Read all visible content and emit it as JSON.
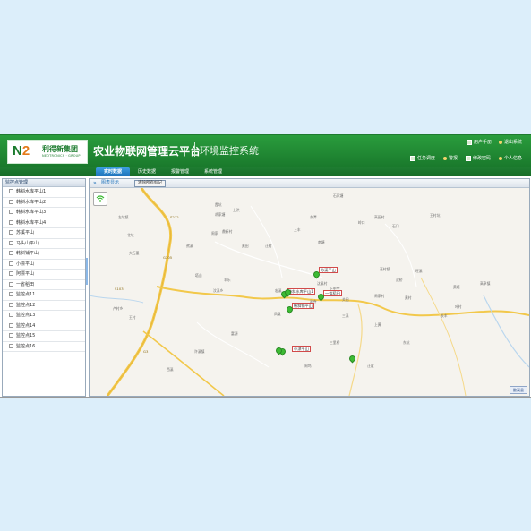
{
  "brand": {
    "mark_n": "N",
    "mark_2": "2",
    "name_cn": "利得新集团",
    "name_en": "NEOTRONICS · GROUP"
  },
  "header": {
    "title": "农业物联网管理云平台",
    "subtitle": "环境监控系统"
  },
  "top_links": [
    {
      "label": "用户手册"
    },
    {
      "label": "退出系统"
    }
  ],
  "tools": [
    {
      "label": "任务调度"
    },
    {
      "label": "警报"
    },
    {
      "label": "修改密码"
    },
    {
      "label": "个人信息"
    }
  ],
  "nav": {
    "tabs": [
      {
        "label": "实时数据",
        "active": true
      },
      {
        "label": "历史数据",
        "active": false
      },
      {
        "label": "报警管理",
        "active": false
      },
      {
        "label": "系统管理",
        "active": false
      }
    ]
  },
  "sidebar": {
    "title": "监控点管理",
    "items": [
      {
        "label": "韩斜水库平山1"
      },
      {
        "label": "韩斜水库平山2"
      },
      {
        "label": "韩斜水库平山3"
      },
      {
        "label": "韩斜水库平山4"
      },
      {
        "label": "苏溪平山"
      },
      {
        "label": "马头山平山"
      },
      {
        "label": "韩斜铺平山"
      },
      {
        "label": "小漂平山"
      },
      {
        "label": "阿漂平山"
      },
      {
        "label": "一省稻田"
      },
      {
        "label": "监控点11"
      },
      {
        "label": "监控点12"
      },
      {
        "label": "监控点13"
      },
      {
        "label": "监控点14"
      },
      {
        "label": "监控点15"
      },
      {
        "label": "监控点16"
      }
    ]
  },
  "main": {
    "title": "图表显示",
    "clear_button": "清除所有标记"
  },
  "map": {
    "places": [
      {
        "label": "左坑镇"
      },
      {
        "label": "石家塘"
      },
      {
        "label": "胡家塘"
      },
      {
        "label": "岭口"
      },
      {
        "label": "高田村"
      },
      {
        "label": "石门"
      },
      {
        "label": "霞坑"
      },
      {
        "label": "上洪"
      },
      {
        "label": "大石墨"
      },
      {
        "label": "北坑"
      },
      {
        "label": "周家"
      },
      {
        "label": "熬溪"
      },
      {
        "label": "上丰"
      },
      {
        "label": "汪村"
      },
      {
        "label": "黄田"
      },
      {
        "label": "王村坑"
      },
      {
        "label": "鼎新村"
      },
      {
        "label": "南塘"
      },
      {
        "label": "汶溪乡"
      },
      {
        "label": "宏溪"
      },
      {
        "label": "关田"
      },
      {
        "label": "卢村乡"
      },
      {
        "label": "塔山"
      },
      {
        "label": "王村"
      },
      {
        "label": "丰乐"
      },
      {
        "label": "汰溪村"
      },
      {
        "label": "三溪"
      },
      {
        "label": "凤凰"
      },
      {
        "label": "周家村"
      },
      {
        "label": "上黄"
      },
      {
        "label": "黄塘"
      },
      {
        "label": "叶村"
      },
      {
        "label": "许溪镇"
      },
      {
        "label": "旺溪"
      },
      {
        "label": "双桥"
      },
      {
        "label": "长丰"
      },
      {
        "label": "西溪"
      },
      {
        "label": "三里桥"
      },
      {
        "label": "汪家"
      },
      {
        "label": "周坞"
      },
      {
        "label": "东坑"
      },
      {
        "label": "富源"
      },
      {
        "label": "高阜镇"
      },
      {
        "label": "岩寺"
      },
      {
        "label": "下中宇"
      },
      {
        "label": "汪村镇"
      },
      {
        "label": "东潭"
      },
      {
        "label": "黄村"
      }
    ],
    "stations": [
      {
        "label": "韩斜水库平山1"
      },
      {
        "label": "苏溪平山"
      },
      {
        "label": "一省稻田"
      },
      {
        "label": "韩斜铺平山"
      },
      {
        "label": "小漂平山"
      }
    ],
    "road_labels": [
      {
        "label": "S212"
      },
      {
        "label": "G205"
      },
      {
        "label": "S103"
      },
      {
        "label": "G3"
      }
    ],
    "scale_label": "歙溪县"
  },
  "colors": {
    "header_green": "#1a7a2c",
    "tab_blue": "#1d70b8",
    "road_yellow": "#f2c84b",
    "marker_green": "#3dbb34"
  }
}
